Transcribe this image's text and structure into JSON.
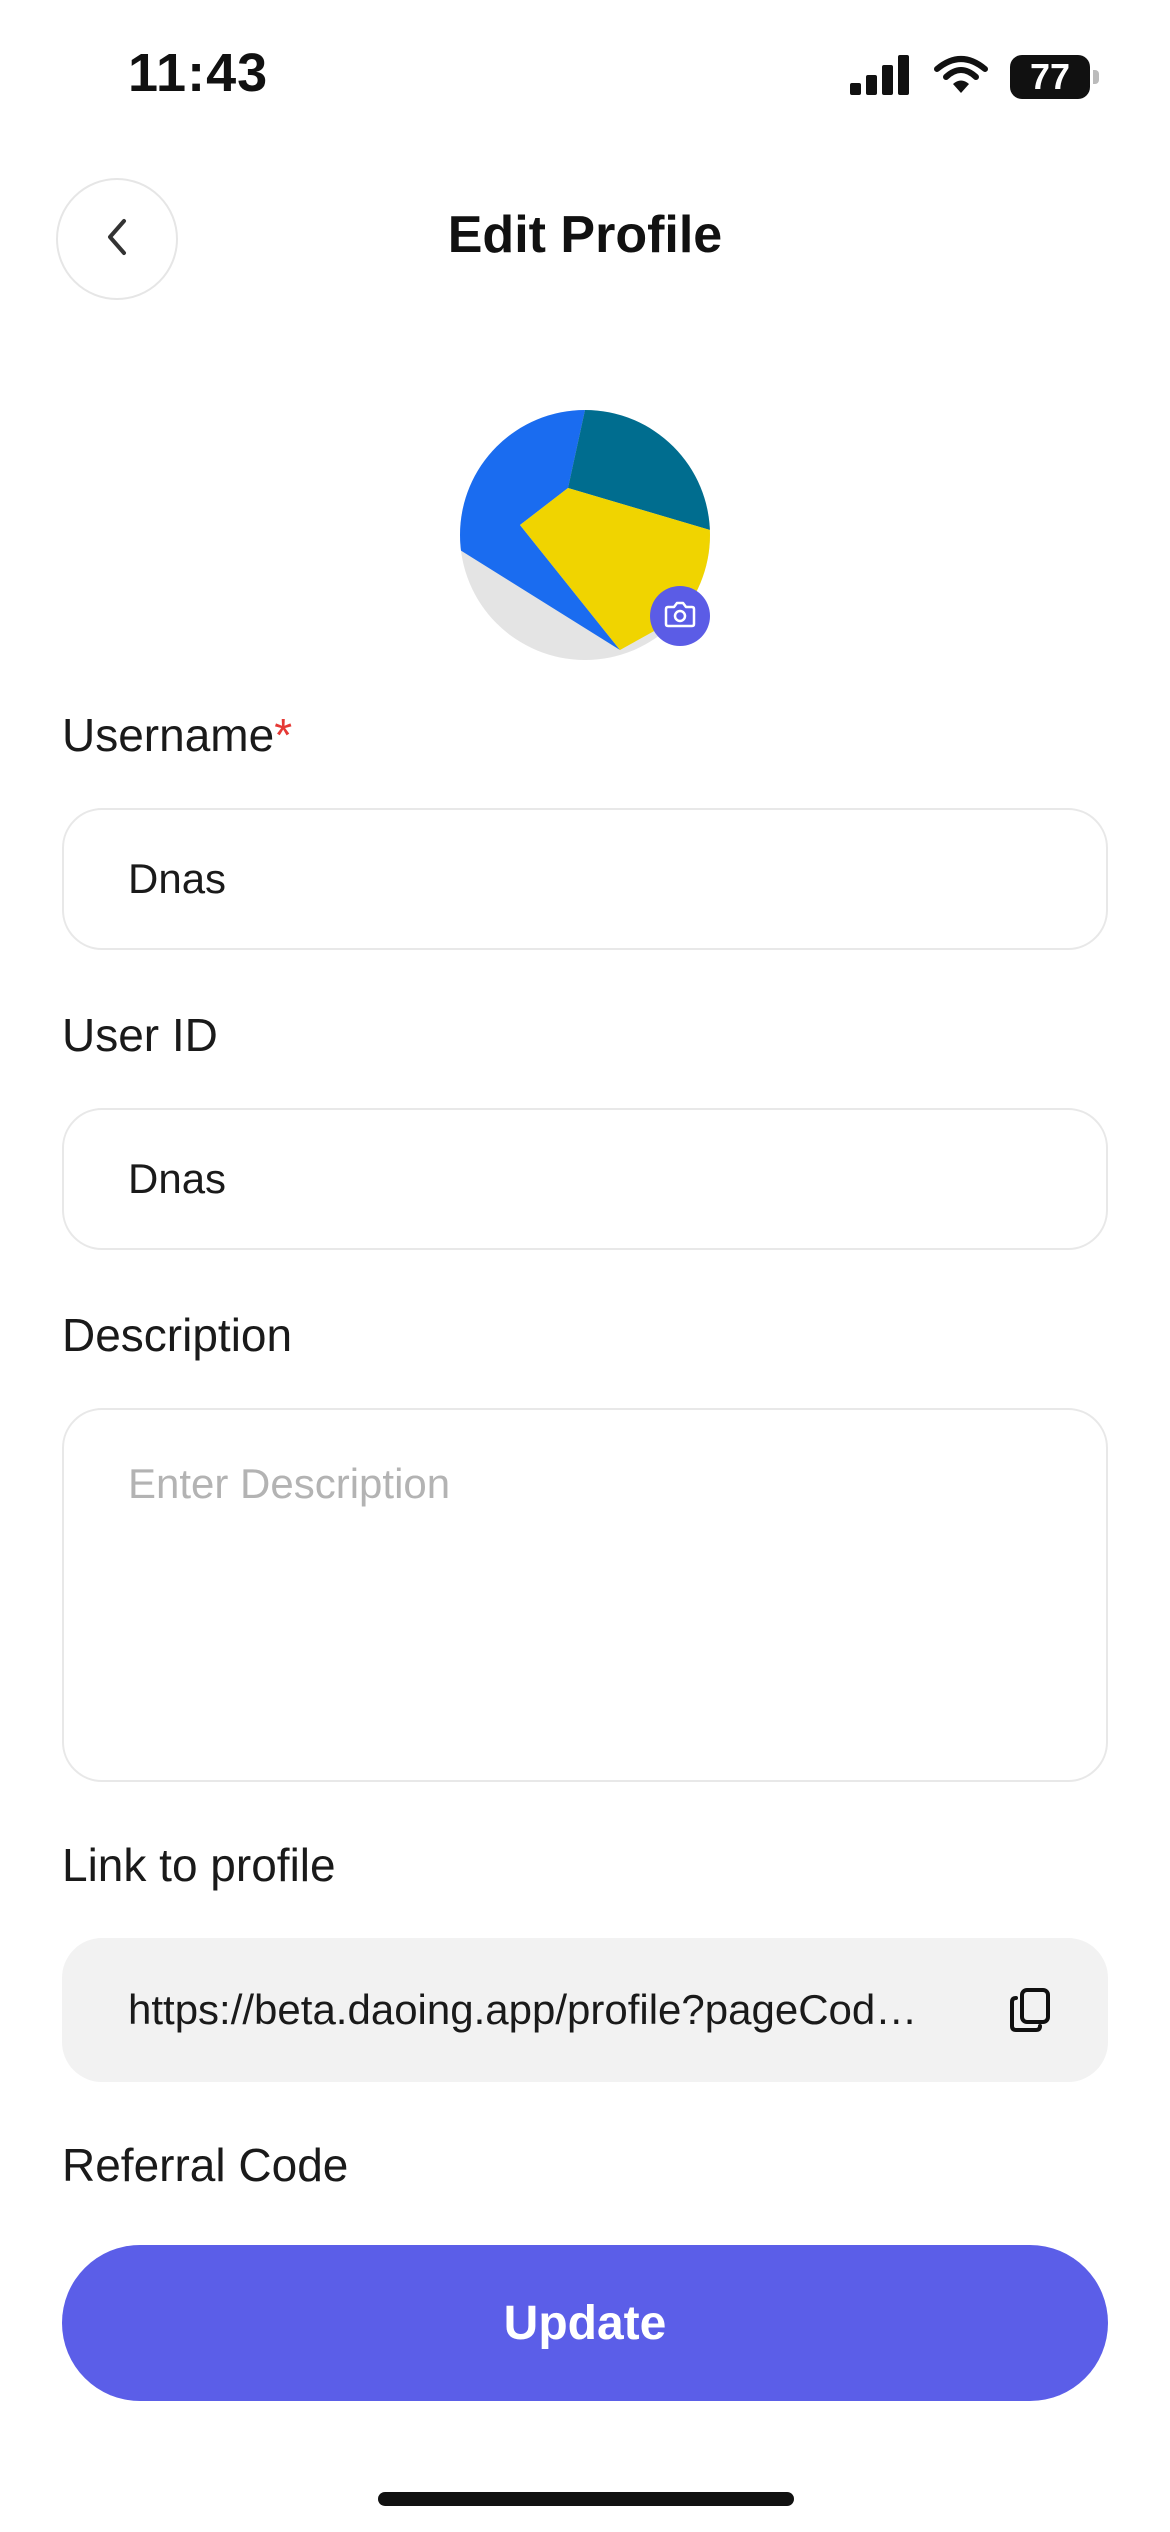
{
  "status_bar": {
    "time": "11:43",
    "battery": "77"
  },
  "header": {
    "title": "Edit Profile"
  },
  "form": {
    "username": {
      "label": "Username",
      "required_mark": "*",
      "value": "Dnas"
    },
    "user_id": {
      "label": "User ID",
      "value": "Dnas"
    },
    "description": {
      "label": "Description",
      "placeholder": "Enter Description",
      "value": ""
    },
    "link": {
      "label": "Link to profile",
      "value": "https://beta.daoing.app/profile?pageCod…"
    },
    "referral": {
      "label": "Referral Code"
    }
  },
  "actions": {
    "update_label": "Update"
  },
  "colors": {
    "accent": "#5b5ee8",
    "required": "#e53935"
  },
  "icons": [
    "signal-icon",
    "wifi-icon",
    "battery-icon",
    "back-icon",
    "camera-icon",
    "copy-icon"
  ]
}
